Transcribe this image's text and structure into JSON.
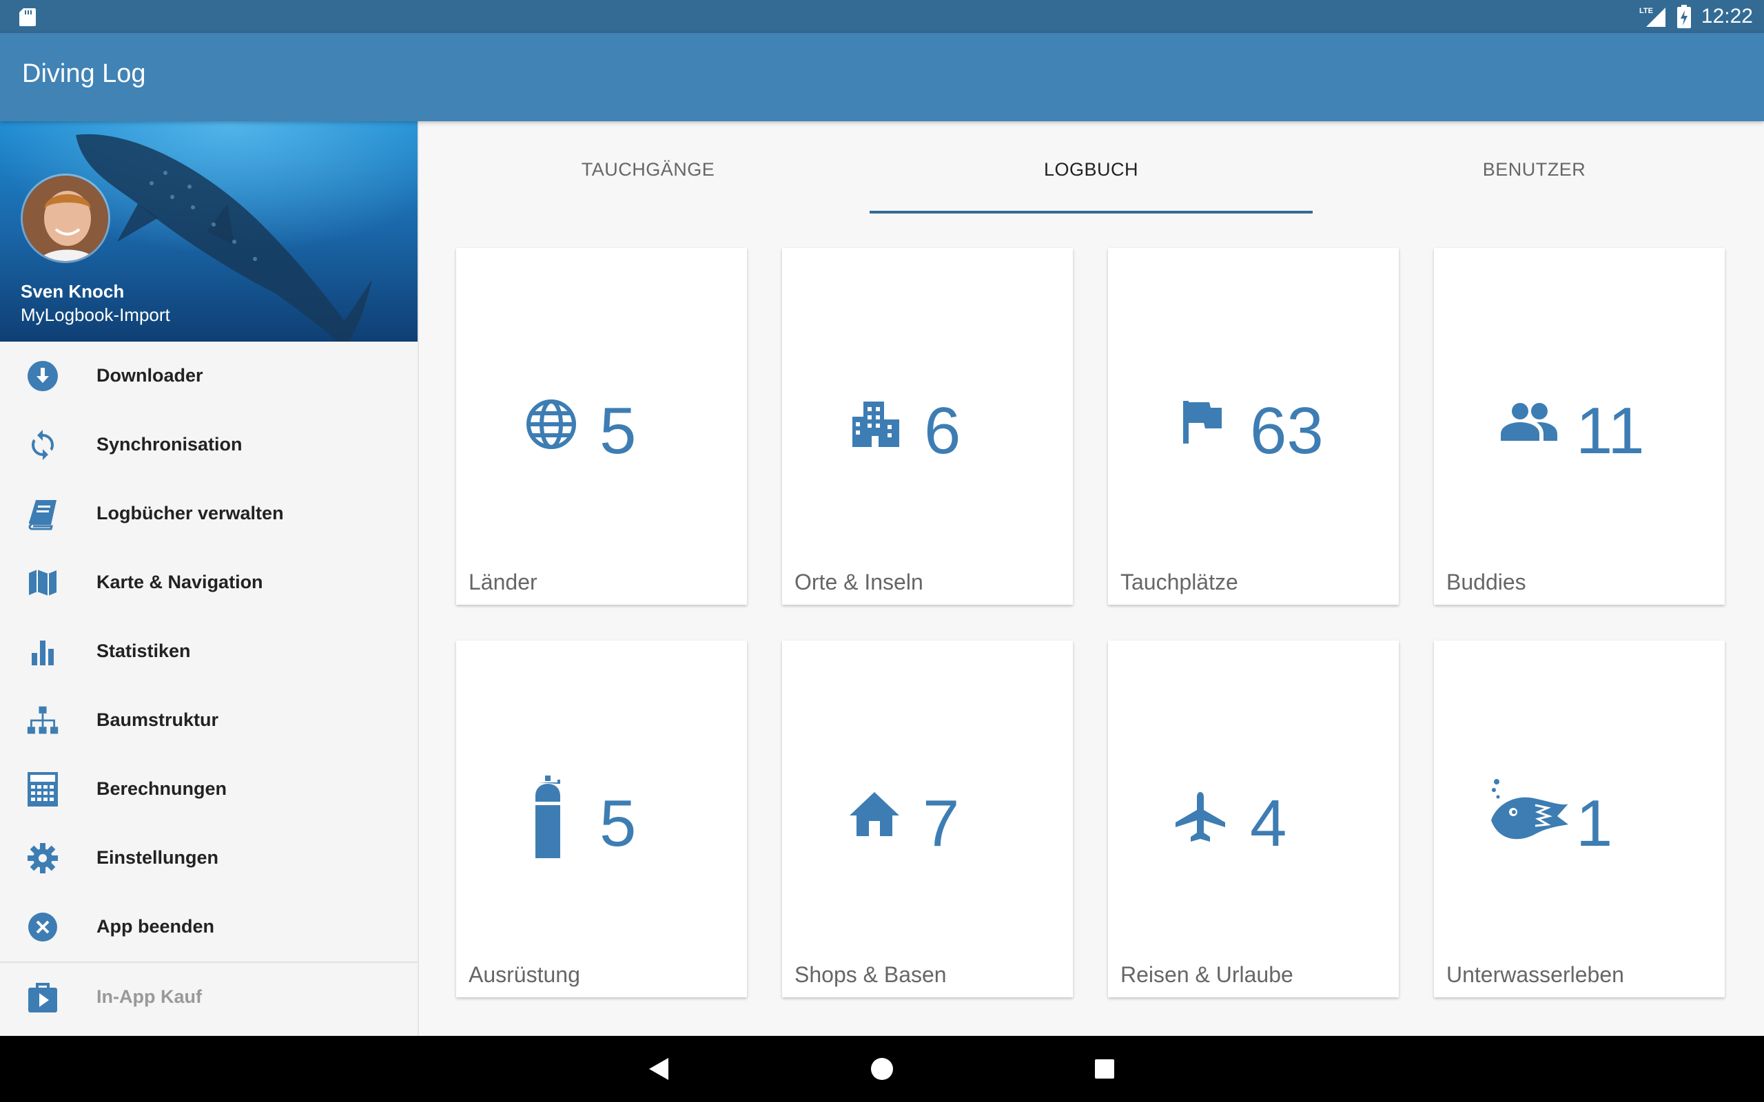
{
  "status_bar": {
    "network": "LTE",
    "time": "12:22",
    "icons": [
      "sd-card-icon",
      "signal-icon",
      "battery-charging-icon"
    ]
  },
  "app_bar": {
    "title": "Diving Log"
  },
  "drawer": {
    "user": {
      "name": "Sven Knoch",
      "subtitle": "MyLogbook-Import"
    },
    "items": [
      {
        "label": "Downloader",
        "icon": "download-circle-icon"
      },
      {
        "label": "Synchronisation",
        "icon": "sync-icon"
      },
      {
        "label": "Logbücher verwalten",
        "icon": "book-icon"
      },
      {
        "label": "Karte & Navigation",
        "icon": "map-icon"
      },
      {
        "label": "Statistiken",
        "icon": "bar-chart-icon"
      },
      {
        "label": "Baumstruktur",
        "icon": "sitemap-icon"
      },
      {
        "label": "Berechnungen",
        "icon": "calculator-icon"
      },
      {
        "label": "Einstellungen",
        "icon": "gear-icon"
      },
      {
        "label": "App beenden",
        "icon": "close-circle-icon"
      }
    ],
    "footer_item": {
      "label": "In-App Kauf",
      "icon": "shopping-bag-icon"
    }
  },
  "tabs": [
    {
      "label": "TAUCHGÄNGE",
      "active": false
    },
    {
      "label": "LOGBUCH",
      "active": true
    },
    {
      "label": "BENUTZER",
      "active": false
    }
  ],
  "cards": [
    {
      "label": "Länder",
      "count": "5",
      "icon": "globe-icon"
    },
    {
      "label": "Orte & Inseln",
      "count": "6",
      "icon": "city-icon"
    },
    {
      "label": "Tauchplätze",
      "count": "63",
      "icon": "flag-icon"
    },
    {
      "label": "Buddies",
      "count": "11",
      "icon": "people-icon"
    },
    {
      "label": "Ausrüstung",
      "count": "5",
      "icon": "tank-icon"
    },
    {
      "label": "Shops & Basen",
      "count": "7",
      "icon": "home-icon"
    },
    {
      "label": "Reisen & Urlaube",
      "count": "4",
      "icon": "airplane-icon"
    },
    {
      "label": "Unterwasserleben",
      "count": "1",
      "icon": "fish-icon"
    }
  ],
  "nav_bar": [
    "back-icon",
    "home-circle-icon",
    "recents-square-icon"
  ],
  "colors": {
    "status_bar": "#336b95",
    "app_bar": "#4183b5",
    "accent": "#3d7db3",
    "tab_indicator": "#336b95"
  }
}
